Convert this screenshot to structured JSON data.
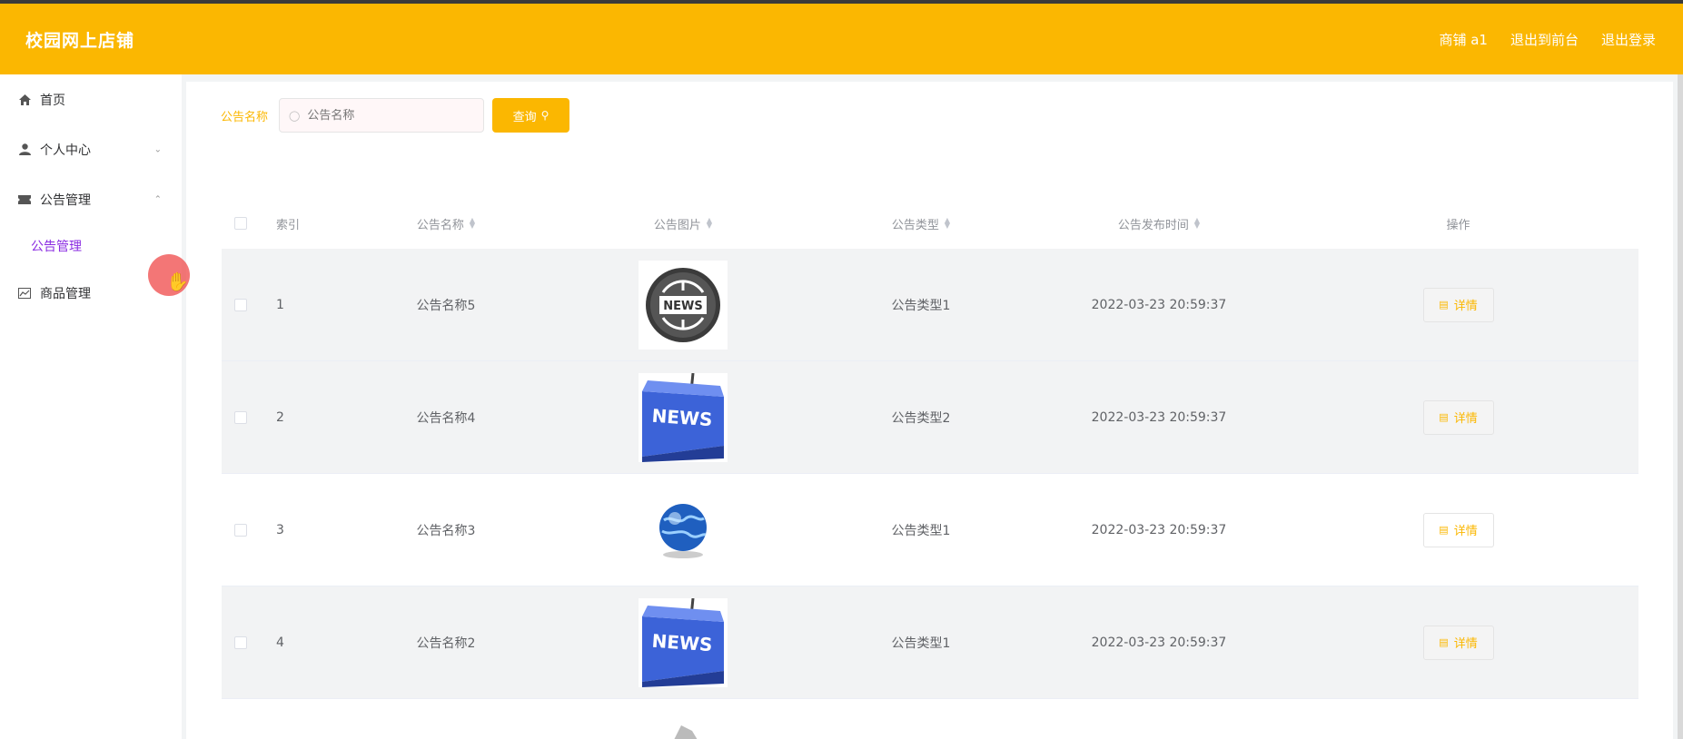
{
  "header": {
    "brand": "校园网上店铺",
    "links": [
      "商铺 a1",
      "退出到前台",
      "退出登录"
    ]
  },
  "sidebar": {
    "items": [
      {
        "label": "首页",
        "icon": "home-icon"
      },
      {
        "label": "个人中心",
        "icon": "user-icon",
        "arrow": "down"
      },
      {
        "label": "公告管理",
        "icon": "ticket-icon",
        "arrow": "up"
      },
      {
        "label": "商品管理",
        "icon": "chart-icon"
      }
    ],
    "submenu": [
      "公告管理"
    ]
  },
  "search": {
    "label": "公告名称",
    "placeholder": "公告名称",
    "value": "",
    "button_label": "查询"
  },
  "table": {
    "columns": [
      "索引",
      "公告名称",
      "公告图片",
      "公告类型",
      "公告发布时间",
      "操作"
    ],
    "rows": [
      {
        "index": "1",
        "name": "公告名称5",
        "image": "news-globe-icon",
        "type": "公告类型1",
        "time": "2022-03-23 20:59:37",
        "action": "详情"
      },
      {
        "index": "2",
        "name": "公告名称4",
        "image": "news-key-icon",
        "type": "公告类型2",
        "time": "2022-03-23 20:59:37",
        "action": "详情"
      },
      {
        "index": "3",
        "name": "公告名称3",
        "image": "globe-icon",
        "type": "公告类型1",
        "time": "2022-03-23 20:59:37",
        "action": "详情"
      },
      {
        "index": "4",
        "name": "公告名称2",
        "image": "news-key-icon",
        "type": "公告类型1",
        "time": "2022-03-23 20:59:37",
        "action": "详情"
      }
    ]
  },
  "colors": {
    "accent": "#fbb701",
    "submenu_active": "#8a2be2"
  }
}
